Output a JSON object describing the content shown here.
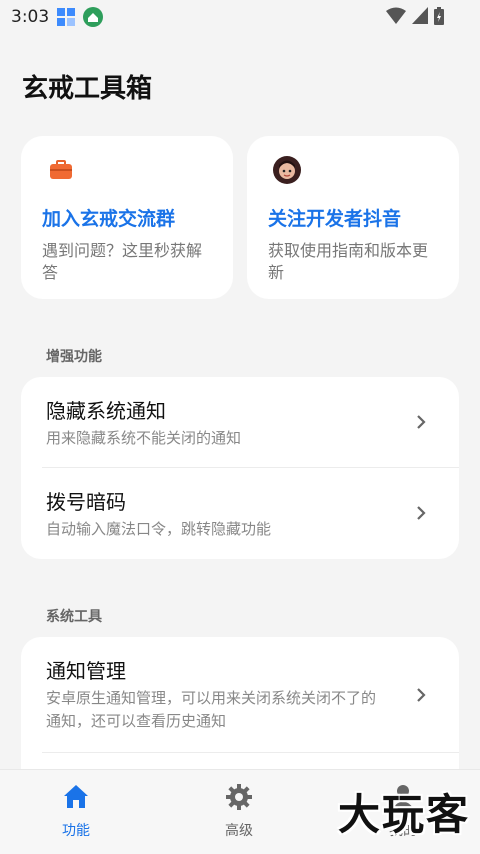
{
  "status_bar": {
    "time": "3:03"
  },
  "page": {
    "title": "玄戒工具箱"
  },
  "cards": [
    {
      "title": "加入玄戒交流群",
      "desc": "遇到问题？这里秒获解答",
      "icon": "briefcase-icon"
    },
    {
      "title": "关注开发者抖音",
      "desc": "获取使用指南和版本更新",
      "icon": "developer-avatar"
    }
  ],
  "sections": {
    "enhance": {
      "label": "增强功能",
      "items": [
        {
          "title": "隐藏系统通知",
          "desc": "用来隐藏系统不能关闭的通知"
        },
        {
          "title": "拨号暗码",
          "desc": "自动输入魔法口令，跳转隐藏功能"
        }
      ]
    },
    "tools": {
      "label": "系统工具",
      "items": [
        {
          "title": "通知管理",
          "desc": "安卓原生通知管理，可以用来关闭系统关闭不了的通知，还可以查看历史通知"
        }
      ]
    }
  },
  "bottom_nav": {
    "items": [
      {
        "label": "功能",
        "icon": "home-icon",
        "active": true
      },
      {
        "label": "高级",
        "icon": "gear-icon",
        "active": false
      },
      {
        "label": "我的",
        "icon": "person-icon",
        "active": false
      }
    ]
  },
  "watermark": {
    "text": "大玩客"
  },
  "colors": {
    "accent": "#1a73e8",
    "background": "#f4f4f4",
    "card": "#ffffff"
  }
}
